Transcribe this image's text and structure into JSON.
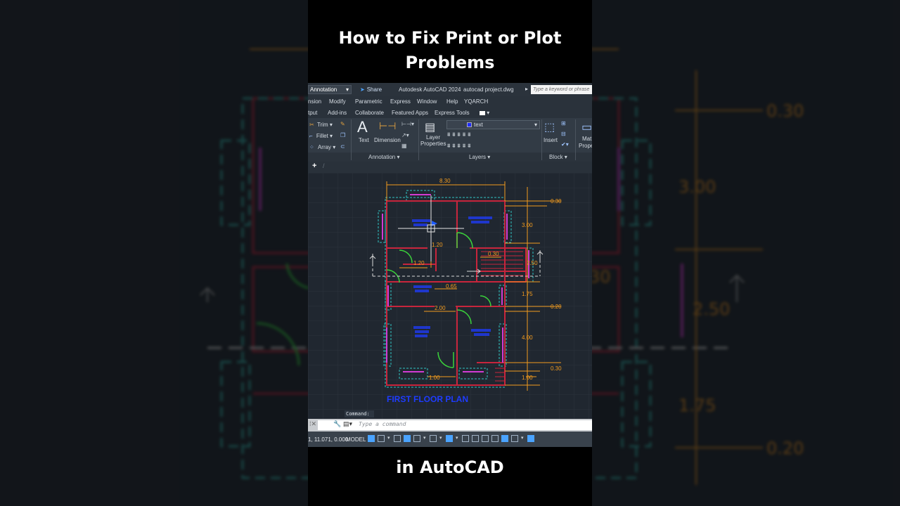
{
  "captions": {
    "top_line1": "How to Fix Print or Plot",
    "top_line2": "Problems",
    "bottom": "in AutoCAD"
  },
  "titlebar": {
    "workspace": "Annotation",
    "share": "Share",
    "app_title": "Autodesk AutoCAD 2024",
    "file_name": "autocad project.dwg",
    "search_placeholder": "Type a keyword or phrase"
  },
  "menu": [
    "nsion",
    "Modify",
    "Parametric",
    "Express",
    "Window",
    "Help",
    "YQARCH"
  ],
  "ribbon_tabs": [
    "tput",
    "Add-ins",
    "Collaborate",
    "Featured Apps",
    "Express Tools"
  ],
  "ribbon": {
    "modify_tools": [
      "Trim",
      "Fillet",
      "Array"
    ],
    "text_label": "Text",
    "dimension_label": "Dimension",
    "layer_properties": [
      "Layer",
      "Properties"
    ],
    "current_layer": "text",
    "insert_label": "Insert",
    "match_properties": [
      "Mat",
      "Prope"
    ],
    "panels": {
      "annotation": "Annotation",
      "layers": "Layers",
      "block": "Block"
    }
  },
  "drawing": {
    "title": "FIRST FLOOR PLAN",
    "dims": {
      "overall_width": "8.30",
      "right": [
        "0.30",
        "3.00",
        "2.50",
        "1.75",
        "0.20",
        "4.00",
        "0.30",
        "1.00"
      ],
      "interior": [
        "1.20",
        "1.20",
        "0.30",
        "0.65",
        "2.00",
        "1.00"
      ]
    }
  },
  "background_dims": [
    "0.30",
    "3.00",
    "2.50",
    "30",
    "1.75",
    "0.20"
  ],
  "command": {
    "history_label": "Command:",
    "placeholder": "Type a command"
  },
  "status": {
    "coords": "1, 11.071, 0.000",
    "model": "MODEL"
  },
  "colors": {
    "acad_bg": "#212830",
    "viewport_bg": "#202730",
    "wall": "#c8253c",
    "dim": "#f29b1e",
    "door": "#3bd23b",
    "window": "#d23bd2",
    "cyan": "#2fc4c4",
    "label_blue": "#1e3cff"
  }
}
